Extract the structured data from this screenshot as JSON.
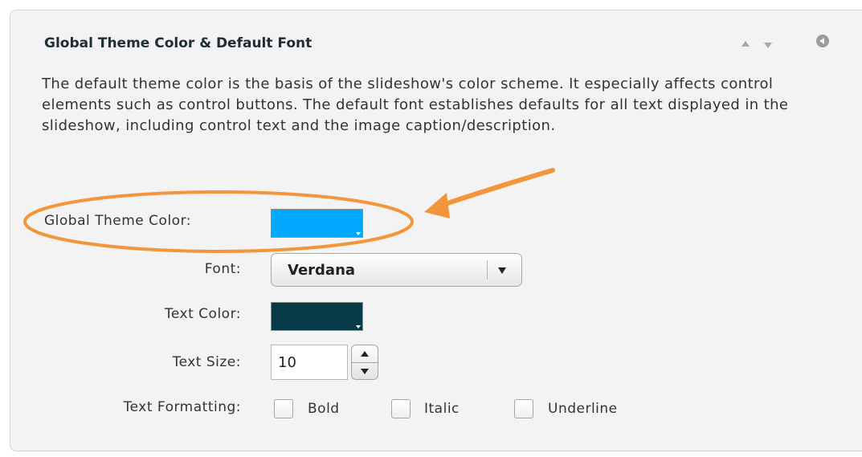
{
  "panel": {
    "title": "Global Theme Color & Default Font",
    "description": "The default theme color is the basis of the slideshow's color scheme. It especially affects control elements such as control buttons. The default font establishes defaults for all text displayed in the slideshow, including control text and the image caption/description."
  },
  "fields": {
    "global_theme_color": {
      "label": "Global Theme Color:",
      "color": "#00a8ff"
    },
    "font": {
      "label": "Font:",
      "value": "Verdana"
    },
    "text_color": {
      "label": "Text Color:",
      "color": "#073a47"
    },
    "text_size": {
      "label": "Text Size:",
      "value": "10"
    },
    "text_formatting": {
      "label": "Text Formatting:",
      "options": [
        "Bold",
        "Italic",
        "Underline"
      ],
      "checked": [
        false,
        false,
        false
      ]
    }
  },
  "annotation": {
    "color": "#f3953b"
  }
}
